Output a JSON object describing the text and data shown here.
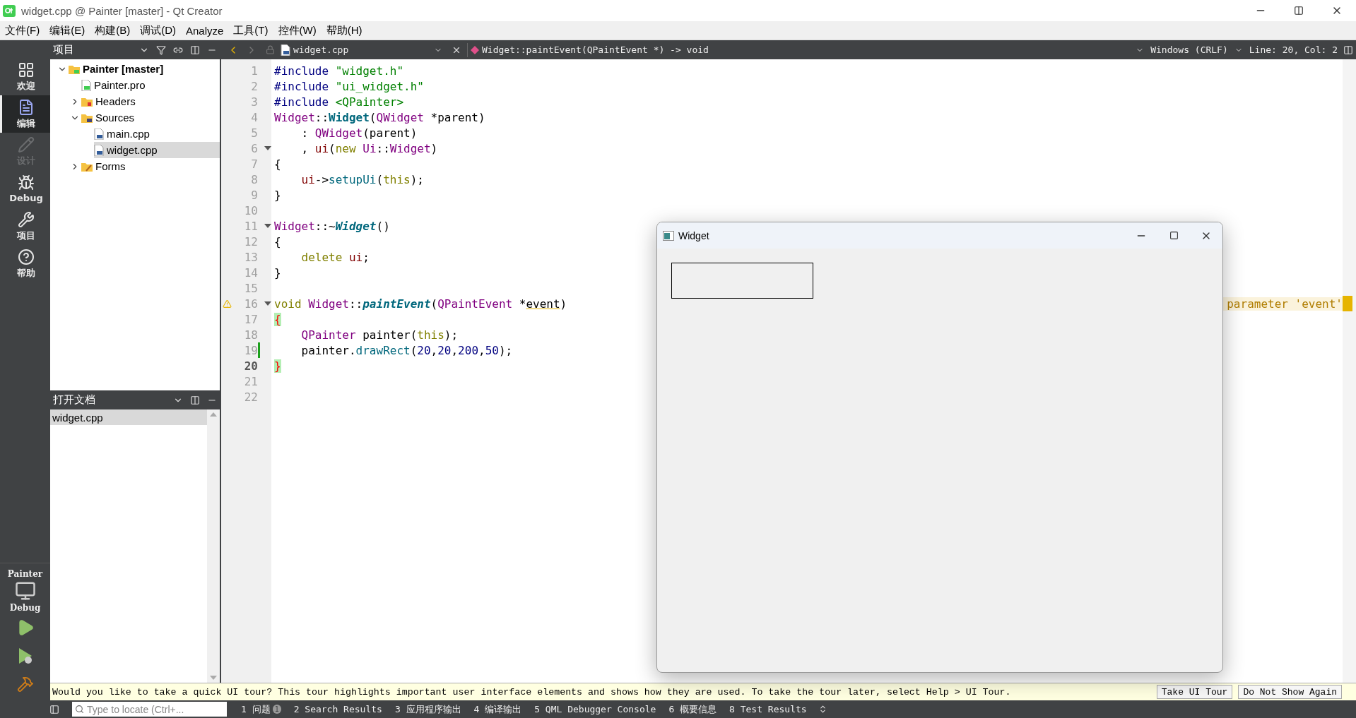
{
  "window": {
    "title": "widget.cpp @ Painter [master] - Qt Creator"
  },
  "menu": [
    "文件(F)",
    "编辑(E)",
    "构建(B)",
    "调试(D)",
    "Analyze",
    "工具(T)",
    "控件(W)",
    "帮助(H)"
  ],
  "modes": [
    {
      "label": "欢迎",
      "kind": "welcome",
      "selected": false,
      "disabled": false
    },
    {
      "label": "编辑",
      "kind": "edit",
      "selected": true,
      "disabled": false
    },
    {
      "label": "设计",
      "kind": "design",
      "selected": false,
      "disabled": true
    },
    {
      "label": "Debug",
      "kind": "debug",
      "selected": false,
      "disabled": false
    },
    {
      "label": "项目",
      "kind": "projects",
      "selected": false,
      "disabled": false
    },
    {
      "label": "帮助",
      "kind": "help",
      "selected": false,
      "disabled": false
    }
  ],
  "kit": {
    "project": "Painter",
    "config": "Debug"
  },
  "project_pane": {
    "title": "项目",
    "tree": [
      {
        "label": "Painter [master]",
        "kind": "project",
        "expanded": true,
        "selected": false,
        "children": [
          {
            "label": "Painter.pro",
            "kind": "pro",
            "selected": false
          },
          {
            "label": "Headers",
            "kind": "headers",
            "expanded": false,
            "selected": false
          },
          {
            "label": "Sources",
            "kind": "sources",
            "expanded": true,
            "selected": false,
            "children": [
              {
                "label": "main.cpp",
                "kind": "cpp",
                "selected": false
              },
              {
                "label": "widget.cpp",
                "kind": "cpp",
                "selected": true
              }
            ]
          },
          {
            "label": "Forms",
            "kind": "forms",
            "expanded": false,
            "selected": false
          }
        ]
      }
    ]
  },
  "open_documents": {
    "title": "打开文档",
    "items": [
      {
        "label": "widget.cpp",
        "selected": true
      }
    ]
  },
  "editor": {
    "file": "widget.cpp",
    "symbol": "Widget::paintEvent(QPaintEvent *) -> void",
    "line_ending": "Windows (CRLF)",
    "position": "Line: 20, Col: 2",
    "lines": [
      {
        "number": "1",
        "fold": false,
        "current": false,
        "changed": false,
        "warning": false,
        "tokens": [
          {
            "kind": "pp",
            "text": "#include"
          },
          {
            "kind": "str",
            "text": " \"widget.h\""
          }
        ]
      },
      {
        "number": "2",
        "fold": false,
        "current": false,
        "changed": false,
        "warning": false,
        "tokens": [
          {
            "kind": "pp",
            "text": "#include"
          },
          {
            "kind": "str",
            "text": " \"ui_widget.h\""
          }
        ]
      },
      {
        "number": "3",
        "fold": false,
        "current": false,
        "changed": false,
        "warning": false,
        "tokens": [
          {
            "kind": "pp",
            "text": "#include"
          },
          {
            "kind": "str",
            "text": " <QPainter>"
          }
        ]
      },
      {
        "number": "4",
        "fold": false,
        "current": false,
        "changed": false,
        "warning": false,
        "tokens": [
          {
            "kind": "type",
            "text": "Widget"
          },
          {
            "kind": "plain",
            "text": "::"
          },
          {
            "kind": "decl",
            "text": "Widget"
          },
          {
            "kind": "plain",
            "text": "("
          },
          {
            "kind": "type",
            "text": "QWidget"
          },
          {
            "kind": "plain",
            "text": " *parent)"
          }
        ]
      },
      {
        "number": "5",
        "fold": false,
        "current": false,
        "changed": false,
        "warning": false,
        "tokens": [
          {
            "kind": "plain",
            "text": "    : "
          },
          {
            "kind": "type",
            "text": "QWidget"
          },
          {
            "kind": "plain",
            "text": "(parent)"
          }
        ]
      },
      {
        "number": "6",
        "fold": true,
        "current": false,
        "changed": false,
        "warning": false,
        "tokens": [
          {
            "kind": "plain",
            "text": "    , "
          },
          {
            "kind": "field",
            "text": "ui"
          },
          {
            "kind": "plain",
            "text": "("
          },
          {
            "kind": "kw",
            "text": "new"
          },
          {
            "kind": "type",
            "text": " Ui"
          },
          {
            "kind": "plain",
            "text": "::"
          },
          {
            "kind": "type",
            "text": "Widget"
          },
          {
            "kind": "plain",
            "text": ")"
          }
        ]
      },
      {
        "number": "7",
        "fold": false,
        "current": false,
        "changed": false,
        "warning": false,
        "tokens": [
          {
            "kind": "plain",
            "text": "{"
          }
        ]
      },
      {
        "number": "8",
        "fold": false,
        "current": false,
        "changed": false,
        "warning": false,
        "tokens": [
          {
            "kind": "field",
            "text": "    ui"
          },
          {
            "kind": "plain",
            "text": "->"
          },
          {
            "kind": "fn",
            "text": "setupUi"
          },
          {
            "kind": "plain",
            "text": "("
          },
          {
            "kind": "kw",
            "text": "this"
          },
          {
            "kind": "plain",
            "text": ");"
          }
        ]
      },
      {
        "number": "9",
        "fold": false,
        "current": false,
        "changed": false,
        "warning": false,
        "tokens": [
          {
            "kind": "plain",
            "text": "}"
          }
        ]
      },
      {
        "number": "10",
        "fold": false,
        "current": false,
        "changed": false,
        "warning": false
      },
      {
        "number": "11",
        "fold": true,
        "current": false,
        "changed": false,
        "warning": false,
        "tokens": [
          {
            "kind": "type",
            "text": "Widget"
          },
          {
            "kind": "plain",
            "text": "::~"
          },
          {
            "kind": "decli",
            "text": "Widget"
          },
          {
            "kind": "plain",
            "text": "()"
          }
        ]
      },
      {
        "number": "12",
        "fold": false,
        "current": false,
        "changed": false,
        "warning": false,
        "tokens": [
          {
            "kind": "plain",
            "text": "{"
          }
        ]
      },
      {
        "number": "13",
        "fold": false,
        "current": false,
        "changed": false,
        "warning": false,
        "tokens": [
          {
            "kind": "kw",
            "text": "    delete"
          },
          {
            "kind": "field",
            "text": " ui"
          },
          {
            "kind": "plain",
            "text": ";"
          }
        ]
      },
      {
        "number": "14",
        "fold": false,
        "current": false,
        "changed": false,
        "warning": false,
        "tokens": [
          {
            "kind": "plain",
            "text": "}"
          }
        ]
      },
      {
        "number": "15",
        "fold": false,
        "current": false,
        "changed": false,
        "warning": false
      },
      {
        "number": "16",
        "fold": true,
        "current": false,
        "changed": false,
        "warning": true,
        "annotation": "parameter 'event'",
        "tokens": [
          {
            "kind": "kw",
            "text": "void"
          },
          {
            "kind": "type",
            "text": " Widget"
          },
          {
            "kind": "plain",
            "text": "::"
          },
          {
            "kind": "decli",
            "text": "paintEvent"
          },
          {
            "kind": "plain",
            "text": "("
          },
          {
            "kind": "type",
            "text": "QPaintEvent"
          },
          {
            "kind": "plain",
            "text": " *"
          },
          {
            "kind": "warnu",
            "text": "event"
          },
          {
            "kind": "plain",
            "text": ")"
          }
        ]
      },
      {
        "number": "17",
        "fold": false,
        "current": false,
        "changed": false,
        "warning": false,
        "tokens": [
          {
            "kind": "brace",
            "text": "{"
          }
        ]
      },
      {
        "number": "18",
        "fold": false,
        "current": false,
        "changed": false,
        "warning": false,
        "tokens": [
          {
            "kind": "type",
            "text": "    QPainter"
          },
          {
            "kind": "plain",
            "text": " painter("
          },
          {
            "kind": "kw",
            "text": "this"
          },
          {
            "kind": "plain",
            "text": ");"
          }
        ]
      },
      {
        "number": "19",
        "fold": false,
        "current": false,
        "changed": true,
        "warning": false,
        "tokens": [
          {
            "kind": "plain",
            "text": "    painter."
          },
          {
            "kind": "fn",
            "text": "drawRect"
          },
          {
            "kind": "plain",
            "text": "("
          },
          {
            "kind": "num",
            "text": "20"
          },
          {
            "kind": "plain",
            "text": ","
          },
          {
            "kind": "num",
            "text": "20"
          },
          {
            "kind": "plain",
            "text": ","
          },
          {
            "kind": "num",
            "text": "200"
          },
          {
            "kind": "plain",
            "text": ","
          },
          {
            "kind": "num",
            "text": "50"
          },
          {
            "kind": "plain",
            "text": ");"
          }
        ]
      },
      {
        "number": "20",
        "fold": false,
        "current": true,
        "changed": false,
        "warning": false,
        "tokens": [
          {
            "kind": "brace",
            "text": "}"
          }
        ]
      },
      {
        "number": "21",
        "fold": false,
        "current": false,
        "changed": false,
        "warning": false
      },
      {
        "number": "22",
        "fold": false,
        "current": false,
        "changed": false,
        "warning": false
      }
    ]
  },
  "tour_bar": {
    "message": "Would you like to take a quick UI tour? This tour highlights important user interface elements and shows how they are used. To take the tour later, select Help > UI Tour.",
    "buttons": [
      "Take UI Tour",
      "Do Not Show Again"
    ]
  },
  "status_bar": {
    "search": {
      "placeholder": "Type to locate (Ctrl+..."
    },
    "panes": [
      {
        "label": "1 问题",
        "badge": "1"
      },
      {
        "label": "2 Search Results"
      },
      {
        "label": "3 应用程序输出"
      },
      {
        "label": "4 编译输出"
      },
      {
        "label": "5 QML Debugger Console"
      },
      {
        "label": "6 概要信息"
      },
      {
        "label": "8 Test Results"
      }
    ]
  },
  "app_window": {
    "title": "Widget"
  }
}
